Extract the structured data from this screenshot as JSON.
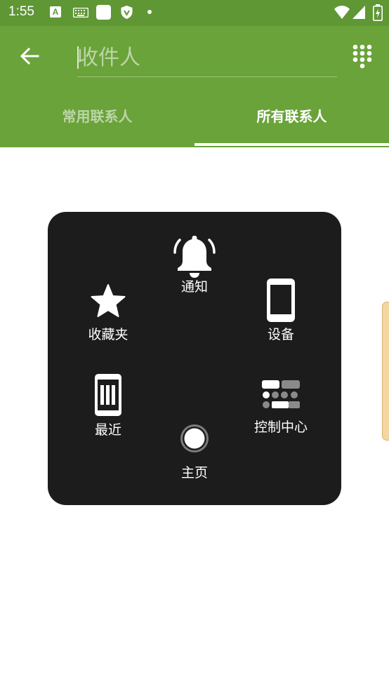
{
  "status_bar": {
    "time": "1:55",
    "a_icon_letter": "A"
  },
  "appbar": {
    "recipient_placeholder": "收件人",
    "tabs": [
      {
        "label": "常用联系人",
        "selected": false
      },
      {
        "label": "所有联系人",
        "selected": true
      }
    ]
  },
  "assistive_menu": {
    "items": [
      {
        "id": "notifications",
        "label": "通知",
        "icon": "bell-icon"
      },
      {
        "id": "favorites",
        "label": "收藏夹",
        "icon": "star-icon"
      },
      {
        "id": "device",
        "label": "设备",
        "icon": "phone-device-icon"
      },
      {
        "id": "recents",
        "label": "最近",
        "icon": "recents-icon"
      },
      {
        "id": "control_center",
        "label": "控制中心",
        "icon": "control-center-icon"
      },
      {
        "id": "home",
        "label": "主页",
        "icon": "home-circle-icon"
      }
    ]
  },
  "colors": {
    "status_bar": "#5f9734",
    "app_bar": "#6aa33a",
    "panel": "#1c1c1c",
    "edge_handle": "#f5d6a2"
  }
}
